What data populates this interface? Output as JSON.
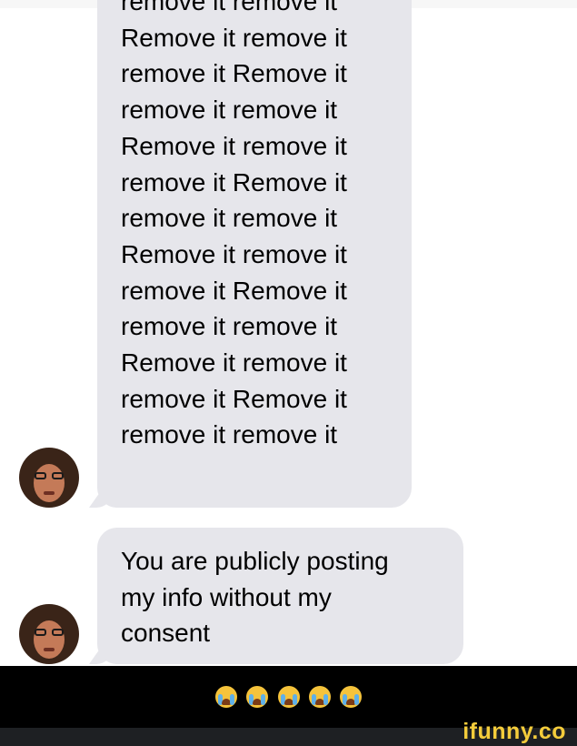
{
  "messages": [
    {
      "text": "remove it remove it\nRemove it remove it\nremove it Remove it\nremove it remove it\nRemove it remove it\nremove it Remove it\nremove it remove it\nRemove it remove it\nremove it Remove it\nremove it remove it\nRemove it remove it\nremove it Remove it\nremove it remove it"
    },
    {
      "text": "You are publicly posting\nmy info without my\nconsent"
    }
  ],
  "reaction": {
    "emoji_icon": "loudly-crying-face-icon",
    "count": 5
  },
  "watermark": {
    "brand": "ifunny.co"
  },
  "colors": {
    "bubble": "#e6e6eb",
    "bar": "#000000",
    "brand": "#f4cc3b"
  }
}
